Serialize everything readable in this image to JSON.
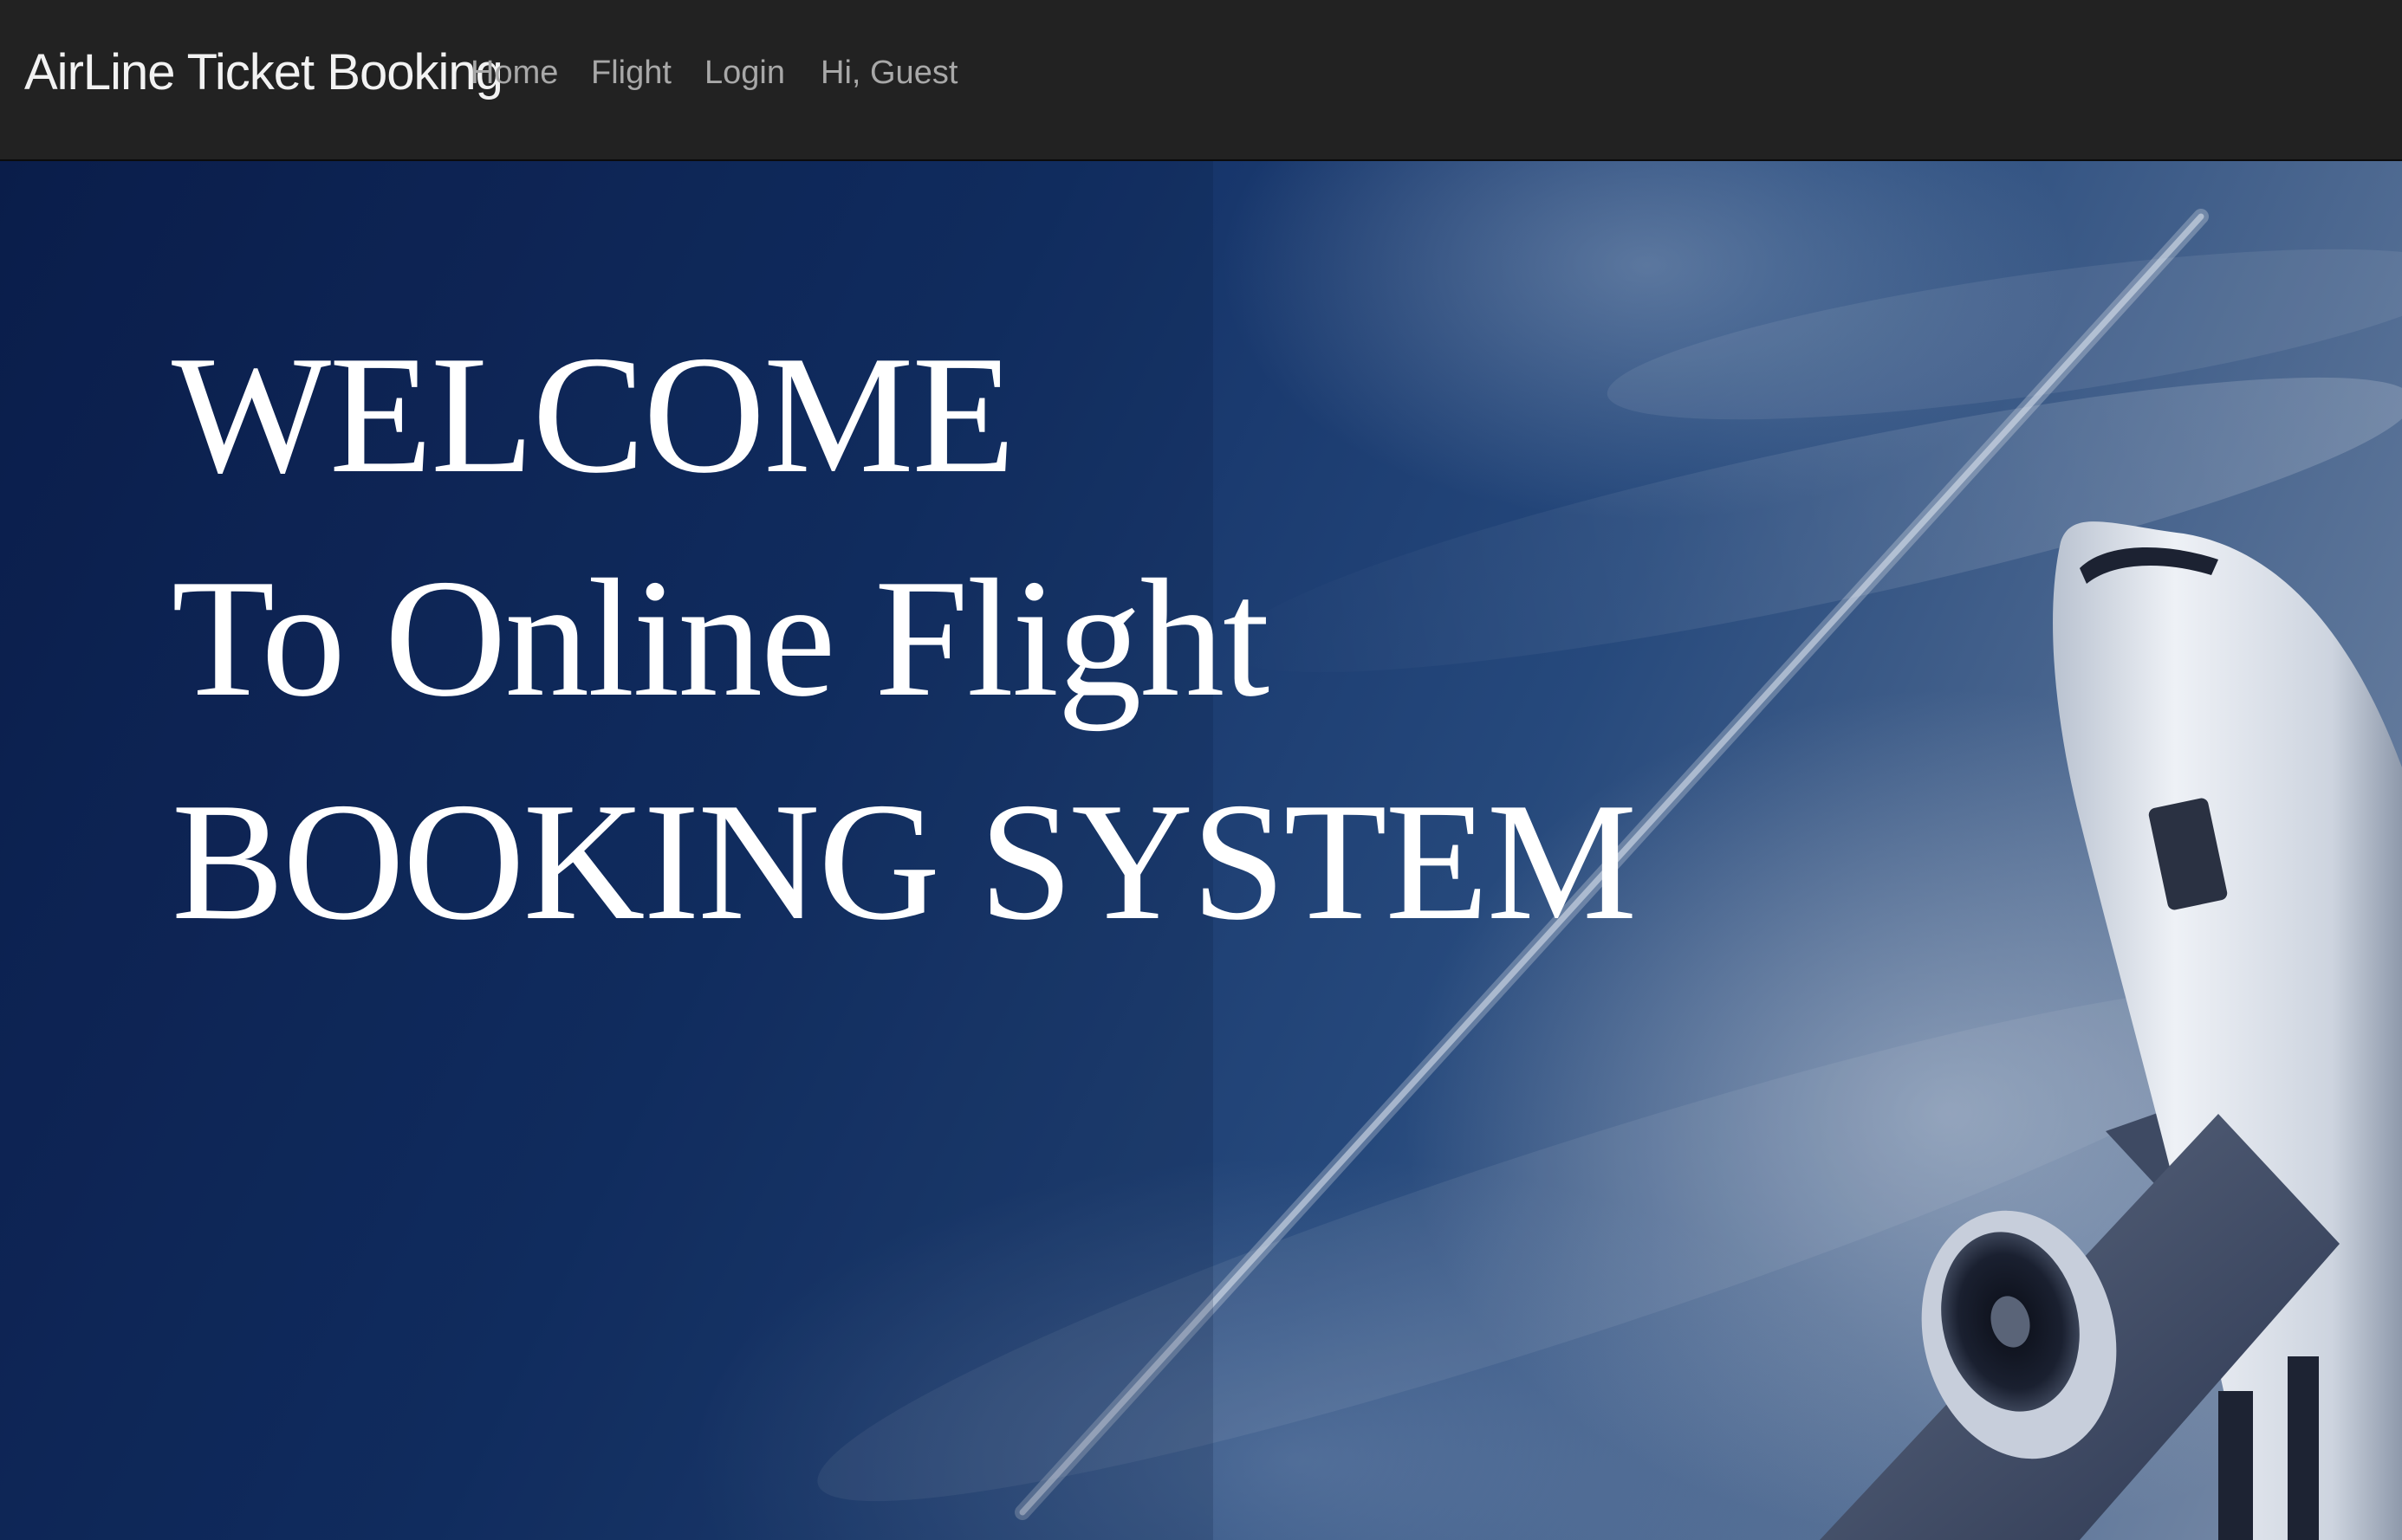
{
  "navbar": {
    "brand": "AirLine Ticket Booking",
    "items": [
      {
        "label": "Home"
      },
      {
        "label": "Flight"
      },
      {
        "label": "Login"
      }
    ],
    "greeting": "Hi, Guest",
    "background": "#222222",
    "link_color": "#a8a8a8"
  },
  "hero": {
    "lines": [
      "WELCOME",
      "To Online Flight",
      "BOOKING SYSTEM"
    ],
    "text_color": "#ffffff",
    "background_image": "airplane-takeoff-sky-photo"
  }
}
